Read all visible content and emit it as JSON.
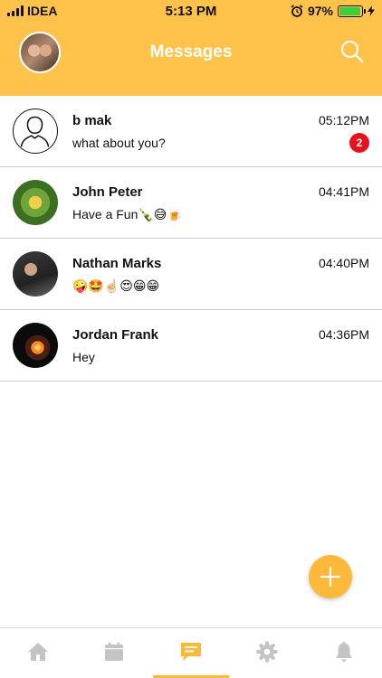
{
  "status_bar": {
    "carrier": "IDEA",
    "time": "5:13 PM",
    "battery_percent": "97%",
    "battery_level": 0.97
  },
  "header": {
    "title": "Messages",
    "avatar_icon": "profile-avatar",
    "search_icon": "search-icon",
    "background_color": "#FFC24A"
  },
  "conversations": [
    {
      "name": "b mak",
      "time": "05:12PM",
      "preview": "what about you?",
      "unread": "2",
      "avatar": "default-person-icon"
    },
    {
      "name": "John Peter",
      "time": "04:41PM",
      "preview": "Have a Fun🍾😅🍺",
      "avatar": "photo-avatar"
    },
    {
      "name": "Nathan Marks",
      "time": "04:40PM",
      "preview": "🤪🤩☝🏻😍😁😁",
      "avatar": "photo-avatar"
    },
    {
      "name": "Jordan Frank",
      "time": "04:36PM",
      "preview": "Hey",
      "avatar": "photo-avatar"
    }
  ],
  "fab": {
    "icon": "plus-icon",
    "color": "#FFB93A"
  },
  "tabs": [
    {
      "name": "home",
      "icon": "home-icon"
    },
    {
      "name": "calendar",
      "icon": "calendar-icon"
    },
    {
      "name": "messages",
      "icon": "chat-icon",
      "active": true
    },
    {
      "name": "settings",
      "icon": "gear-icon"
    },
    {
      "name": "notifications",
      "icon": "bell-icon"
    }
  ],
  "colors": {
    "accent": "#FFB93A",
    "inactive_icon": "#c4c4c4",
    "badge": "#e8121c"
  }
}
